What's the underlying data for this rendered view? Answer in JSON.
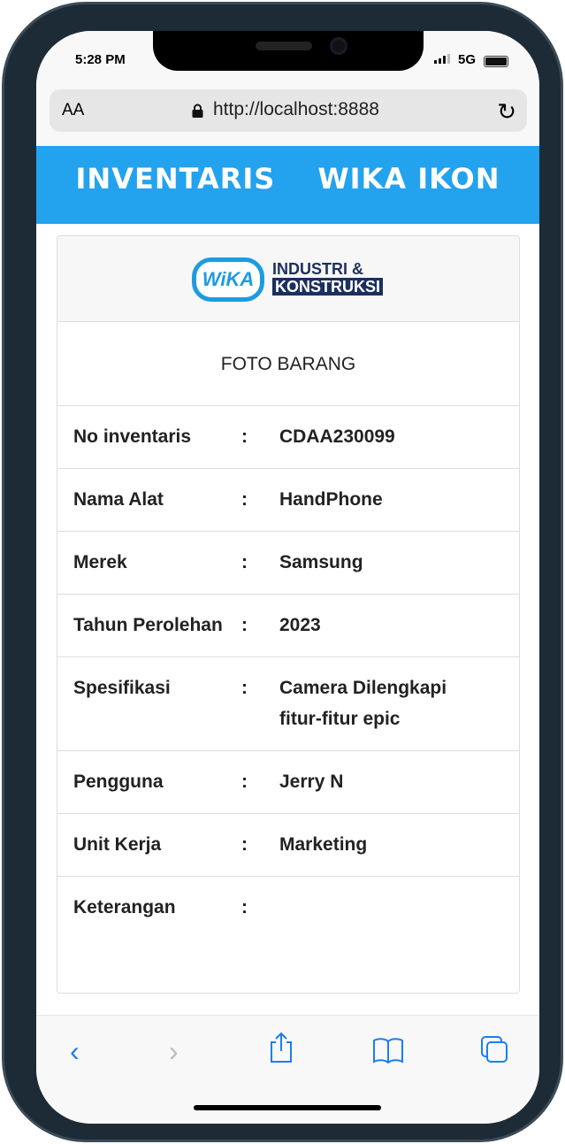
{
  "status": {
    "time": "5:28 PM",
    "network": "5G"
  },
  "browser": {
    "aa": "AA",
    "url": "http://localhost:8888"
  },
  "header": {
    "left": "INVENTARIS",
    "right": "WIKA IKON"
  },
  "logo": {
    "mark": "WiKA",
    "line1": "INDUSTRI &",
    "line2": "KONSTRUKSI"
  },
  "photo_label": "FOTO BARANG",
  "rows": [
    {
      "label": "No inventaris",
      "sep": ":",
      "value": "CDAA230099"
    },
    {
      "label": "Nama Alat",
      "sep": ":",
      "value": "HandPhone"
    },
    {
      "label": "Merek",
      "sep": ":",
      "value": "Samsung"
    },
    {
      "label": "Tahun Perolehan",
      "sep": ":",
      "value": "2023"
    },
    {
      "label": "Spesifikasi",
      "sep": ":",
      "value": "Camera Dilengkapi fitur-fitur epic"
    },
    {
      "label": "Pengguna",
      "sep": ":",
      "value": "Jerry N"
    },
    {
      "label": "Unit Kerja",
      "sep": ":",
      "value": "Marketing"
    },
    {
      "label": "Keterangan",
      "sep": ":",
      "value": ""
    }
  ],
  "colors": {
    "header": "#23a2ee",
    "accent": "#1a7ef2"
  }
}
